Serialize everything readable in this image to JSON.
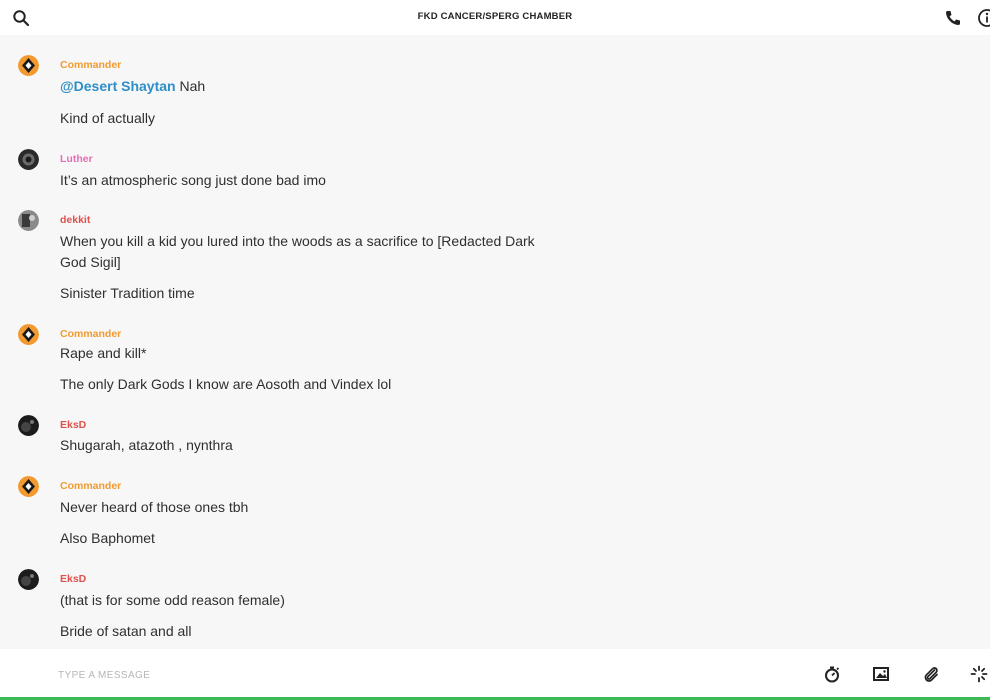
{
  "header": {
    "title": "FKD CANCER/SPERG CHAMBER",
    "left_icon": "search-icon",
    "right_icons": [
      "phone-icon",
      "info-icon"
    ]
  },
  "colors": {
    "Commander": "#f29a2e",
    "Luther": "#e56fb4",
    "dekkit": "#e0504a",
    "EksD": "#e0504a",
    "mention": "#2e8fc7",
    "composer_underline": "#3cba54"
  },
  "messages": [
    {
      "author": "Commander",
      "lines": [
        {
          "mention": "@Desert Shaytan",
          "text": " Nah"
        },
        {
          "text": "Kind of actually"
        }
      ]
    },
    {
      "author": "Luther",
      "lines": [
        {
          "text": "It’s an atmospheric song just done bad imo"
        }
      ]
    },
    {
      "author": "dekkit",
      "lines": [
        {
          "text": "When you kill a kid you lured into the woods as a sacrifice to [Redacted Dark"
        },
        {
          "text": "God Sigil]"
        },
        {
          "text": "Sinister Tradition time"
        }
      ]
    },
    {
      "author": "Commander",
      "lines": [
        {
          "text": "Rape and kill*"
        },
        {
          "text": "The only Dark Gods I know are Aosoth and Vindex lol"
        }
      ]
    },
    {
      "author": "EksD",
      "lines": [
        {
          "text": "Shugarah, atazoth , nynthra"
        }
      ]
    },
    {
      "author": "Commander",
      "lines": [
        {
          "text": "Never heard of those ones tbh"
        },
        {
          "text": "Also Baphomet"
        }
      ]
    },
    {
      "author": "EksD",
      "lines": [
        {
          "text": "(that is for some odd reason female)"
        },
        {
          "text": "Bride of satan and all"
        }
      ]
    }
  ],
  "composer": {
    "placeholder": "TYPE A MESSAGE",
    "icons": [
      "timer-icon",
      "image-icon",
      "attachment-icon",
      "sparkle-icon"
    ]
  }
}
